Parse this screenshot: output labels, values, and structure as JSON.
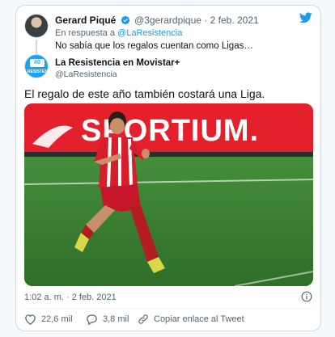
{
  "reply": {
    "name": "Gerard Piqué",
    "handle": "@3gerardpique",
    "separator": "·",
    "date": "2 feb. 2021",
    "reply_prefix": "En respuesta a",
    "reply_to": "@LaResistencia",
    "text": "No sabía que los regalos cuentan como Ligas…"
  },
  "quoted": {
    "name": "La Resistencia en Movistar",
    "name_suffix": "+",
    "handle": "@LaResistencia",
    "avatar_top": "#0",
    "avatar_bottom": "RESISTENCIA",
    "text": "El regalo de este año también costará una Liga."
  },
  "media": {
    "banner_text": "SPORTIUM.",
    "banner_color": "#e3202b",
    "pitch_color": "#3f8a36"
  },
  "meta": {
    "timestamp": "1:02 a. m. · 2 feb. 2021"
  },
  "actions": {
    "likes": "22,6 mil",
    "replies": "3,8 mil",
    "copy_link": "Copiar enlace al Tweet"
  },
  "colors": {
    "link": "#1d9bf0",
    "secondary_text": "#536471",
    "verified": "#1d9bf0"
  }
}
